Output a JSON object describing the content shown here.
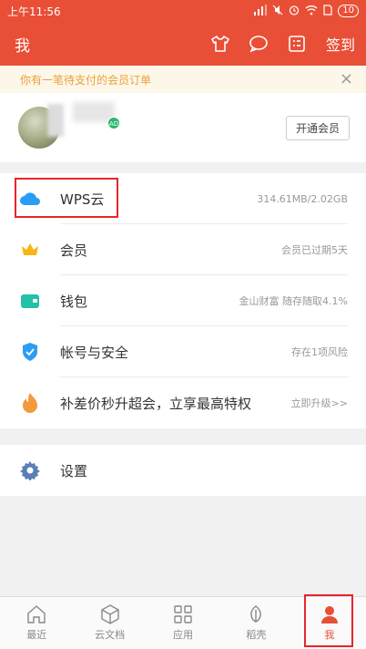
{
  "status_bar": {
    "time": "上午11:56",
    "battery": "10"
  },
  "header": {
    "title": "我",
    "signin": "签到"
  },
  "notice": {
    "text": "你有一笔待支付的会员订单",
    "close": "×"
  },
  "profile": {
    "badge": "AD",
    "open_vip": "开通会员"
  },
  "menu": [
    {
      "label": "WPS云",
      "value": "314.61MB/2.02GB"
    },
    {
      "label": "会员",
      "value": "会员已过期5天"
    },
    {
      "label": "钱包",
      "value": "金山财富 随存随取4.1%"
    },
    {
      "label": "帐号与安全",
      "value": "存在1项风险"
    },
    {
      "label": "补差价秒升超会，立享最高特权",
      "value": "立即升级>>"
    }
  ],
  "settings": {
    "label": "设置"
  },
  "tabs": [
    {
      "label": "最近"
    },
    {
      "label": "云文档"
    },
    {
      "label": "应用"
    },
    {
      "label": "稻壳"
    },
    {
      "label": "我"
    }
  ],
  "colors": {
    "brand": "#e84f36",
    "accent_red": "#e8252a",
    "notice_text": "#e9a23b"
  }
}
